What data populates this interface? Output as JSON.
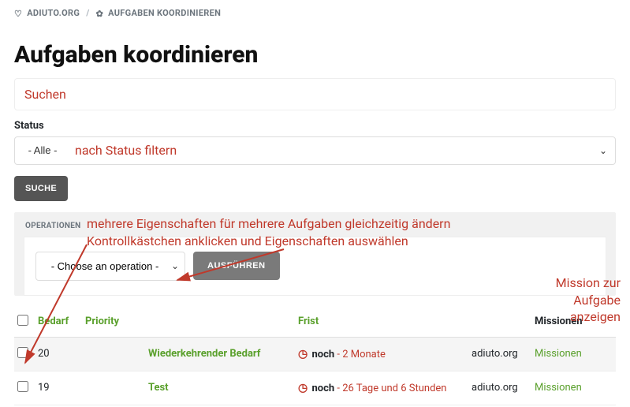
{
  "breadcrumb": {
    "site": "ADIUTO.ORG",
    "page": "AUFGABEN KOORDINIEREN"
  },
  "page_title": "Aufgaben koordinieren",
  "search": {
    "annotation": "Suchen"
  },
  "status": {
    "label": "Status",
    "selected": "- Alle -",
    "annotation": "nach Status filtern"
  },
  "search_button": "SUCHE",
  "operations": {
    "panel_label": "OPERATIONEN",
    "select_placeholder": "- Choose an operation -",
    "execute_button": "AUSFÜHREN"
  },
  "annotations": {
    "ops_line1": "mehrere Eigenschaften für mehrere Aufgaben gleichzeitig ändern",
    "ops_line2": "Kontrollkästchen anklicken und Eigenschaften auswählen",
    "mission_line1": "Mission zur",
    "mission_line2": "Aufgabe",
    "mission_line3": "anzeigen"
  },
  "colors": {
    "accent_green": "#5aa02c",
    "annotation_red": "#c0392b"
  },
  "table": {
    "headers": {
      "bedarf": "Bedarf",
      "priority": "Priority",
      "title": "",
      "frist": "Frist",
      "source": "",
      "missionen": "Missionen"
    },
    "rows": [
      {
        "bedarf": "20",
        "priority": "",
        "title": "Wiederkehrender Bedarf",
        "frist_prefix": "noch",
        "frist_value": "2 Monate",
        "source": "adiuto.org",
        "mission_link": "Missionen"
      },
      {
        "bedarf": "19",
        "priority": "",
        "title": "Test",
        "frist_prefix": "noch",
        "frist_value": "26 Tage und 6 Stunden",
        "source": "adiuto.org",
        "mission_link": "Missionen"
      }
    ]
  }
}
